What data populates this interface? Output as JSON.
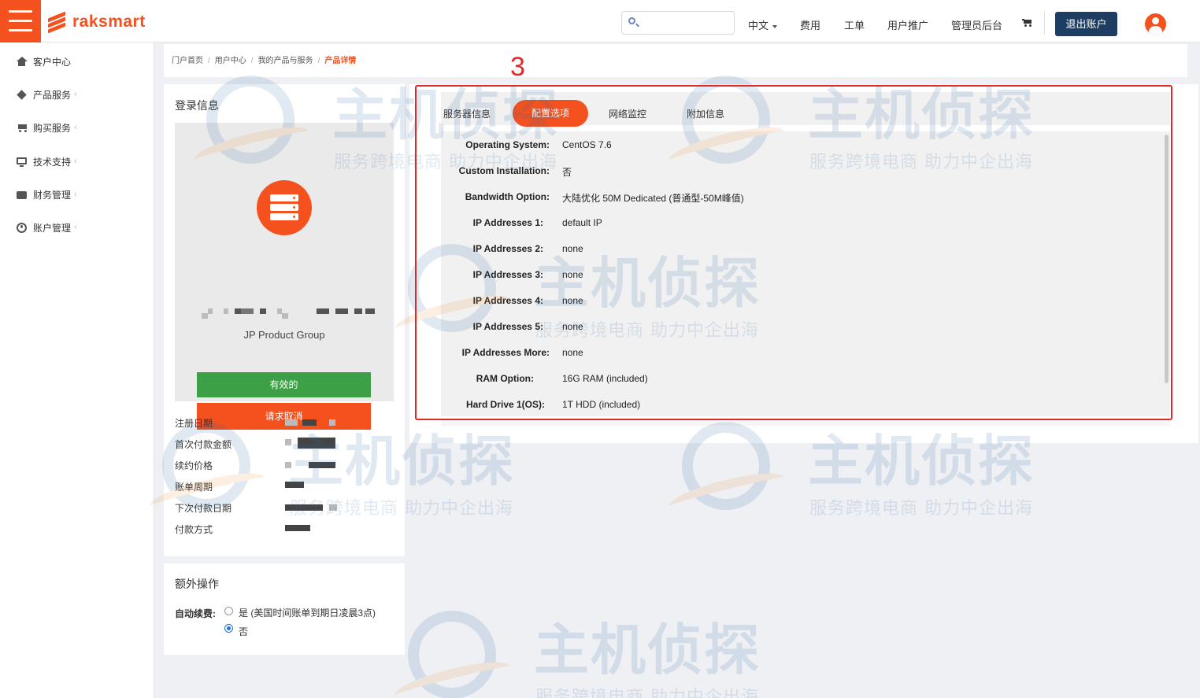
{
  "app": {
    "brand": "raksmart"
  },
  "header": {
    "search_placeholder": "",
    "nav": [
      {
        "label": "中文"
      },
      {
        "label": "费用"
      },
      {
        "label": "工单"
      },
      {
        "label": "用户推广"
      },
      {
        "label": "管理员后台"
      }
    ],
    "logout_label": "退出账户",
    "colors": {
      "accent": "#f4511e",
      "logout_bg": "#1e3d63"
    }
  },
  "sidebar": {
    "items": [
      {
        "label": "客户中心",
        "icon": "home-icon"
      },
      {
        "label": "产品服务",
        "icon": "cube-icon",
        "chevron": "‹"
      },
      {
        "label": "购买服务",
        "icon": "cart-icon",
        "chevron": "‹"
      },
      {
        "label": "技术支持",
        "icon": "monitor-icon",
        "chevron": "‹"
      },
      {
        "label": "财务管理",
        "icon": "wallet-icon",
        "chevron": "‹"
      },
      {
        "label": "账户管理",
        "icon": "account-icon",
        "chevron": "‹"
      }
    ]
  },
  "breadcrumb": {
    "items": [
      "门户首页",
      "用户中心",
      "我的产品与服务",
      "产品详情"
    ],
    "sep": "/"
  },
  "login_info": {
    "title": "登录信息",
    "product_group": "JP Product Group",
    "status_label": "有效的",
    "cancel_label": "请求取消",
    "fields": [
      {
        "label": "注册日期"
      },
      {
        "label": "首次付款金额"
      },
      {
        "label": "续约价格"
      },
      {
        "label": "账单周期"
      },
      {
        "label": "下次付款日期"
      },
      {
        "label": "付款方式"
      }
    ]
  },
  "extra_ops": {
    "title": "额外操作",
    "auto_renew_label": "自动续费:",
    "options": [
      {
        "label": "是 (美国时间账单到期日凌晨3点)",
        "checked": false
      },
      {
        "label": "否",
        "checked": true
      }
    ]
  },
  "tabs": [
    {
      "label": "服务器信息",
      "active": false
    },
    {
      "label": "配置选项",
      "active": true
    },
    {
      "label": "网络监控",
      "active": false
    },
    {
      "label": "附加信息",
      "active": false
    }
  ],
  "config": [
    {
      "label": "Operating System:",
      "value": "CentOS 7.6"
    },
    {
      "label": "Custom Installation:",
      "value": "否"
    },
    {
      "label": "Bandwidth Option:",
      "value": "大陆优化 50M Dedicated (普通型-50M峰值)"
    },
    {
      "label": "IP Addresses 1:",
      "value": "default IP"
    },
    {
      "label": "IP Addresses 2:",
      "value": "none"
    },
    {
      "label": "IP Addresses 3:",
      "value": "none"
    },
    {
      "label": "IP Addresses 4:",
      "value": "none"
    },
    {
      "label": "IP Addresses 5:",
      "value": "none"
    },
    {
      "label": "IP Addresses More:",
      "value": "none"
    },
    {
      "label": "RAM Option:",
      "value": "16G RAM (included)"
    },
    {
      "label": "Hard Drive 1(OS):",
      "value": "1T HDD (included)"
    }
  ],
  "annotation": {
    "number": "3",
    "color": "#e02a2a"
  },
  "watermark": {
    "big": "主机侦探",
    "small": "服务跨境电商 助力中企出海"
  }
}
